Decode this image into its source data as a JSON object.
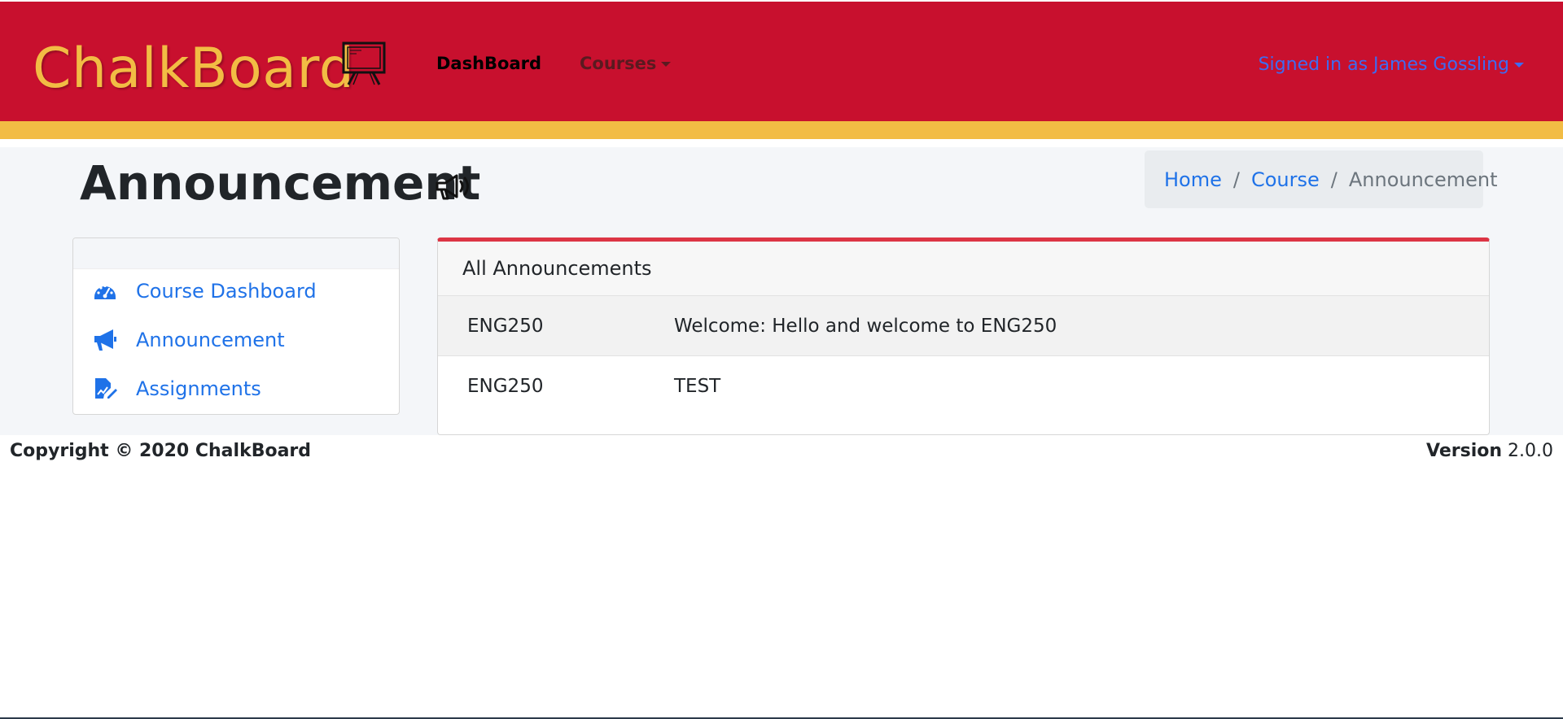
{
  "navbar": {
    "brand": "ChalkBoard",
    "dashboard_label": "DashBoard",
    "courses_label": "Courses",
    "user_label": "Signed in as James Gossling"
  },
  "page": {
    "title": "Announcement"
  },
  "breadcrumb": {
    "items": [
      "Home",
      "Course",
      "Announcement"
    ]
  },
  "sidebar": {
    "items": [
      {
        "label": "Course Dashboard",
        "icon": "dashboard-icon"
      },
      {
        "label": "Announcement",
        "icon": "megaphone-icon"
      },
      {
        "label": "Assignments",
        "icon": "assignment-icon"
      }
    ]
  },
  "announcements": {
    "header": "All Announcements",
    "rows": [
      {
        "course": "ENG250",
        "message": "Welcome: Hello and welcome to ENG250"
      },
      {
        "course": "ENG250",
        "message": "TEST"
      }
    ]
  },
  "footer": {
    "copyright": "Copyright © 2020 ChalkBoard",
    "version_label": "Version",
    "version_value": "2.0.0"
  },
  "colors": {
    "navbar": "#c8102e",
    "gold": "#f2bc44",
    "link": "#1f72e8",
    "accent_border": "#dc3545"
  }
}
